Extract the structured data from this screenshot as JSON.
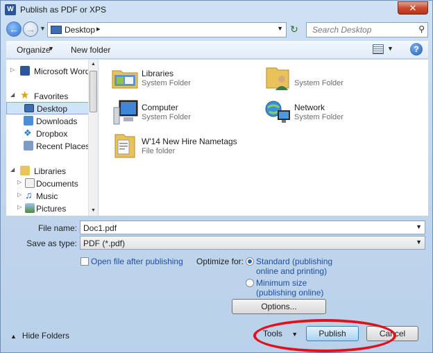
{
  "window": {
    "title": "Publish as PDF or XPS",
    "close_label": "✕",
    "app_icon_letter": "W"
  },
  "navbar": {
    "back_icon": "back-arrow-icon",
    "forward_icon": "forward-arrow-icon",
    "address": "Desktop",
    "search_placeholder": "Search Desktop"
  },
  "toolbar": {
    "organize": "Organize",
    "new_folder": "New folder"
  },
  "nav_pane": {
    "items": [
      {
        "label": "Microsoft Word",
        "icon": "word-icon",
        "caret": "▷"
      },
      {
        "label": "Favorites",
        "icon": "star-icon",
        "caret": "◢"
      },
      {
        "label": "Desktop",
        "icon": "desktop-icon",
        "selected": true
      },
      {
        "label": "Downloads",
        "icon": "downloads-icon"
      },
      {
        "label": "Dropbox",
        "icon": "dropbox-icon"
      },
      {
        "label": "Recent Places",
        "icon": "recent-places-icon"
      },
      {
        "label": "Libraries",
        "icon": "libraries-icon",
        "caret": "◢"
      },
      {
        "label": "Documents",
        "icon": "documents-icon",
        "caret": "▷"
      },
      {
        "label": "Music",
        "icon": "music-icon",
        "caret": "▷"
      },
      {
        "label": "Pictures",
        "icon": "pictures-icon",
        "caret": "▷"
      }
    ]
  },
  "files": [
    {
      "name": "Libraries",
      "type": "System Folder",
      "icon": "libraries-folder-icon"
    },
    {
      "name": "",
      "type": "System Folder",
      "icon": "user-folder-icon"
    },
    {
      "name": "Computer",
      "type": "System Folder",
      "icon": "computer-icon"
    },
    {
      "name": "Network",
      "type": "System Folder",
      "icon": "network-icon"
    },
    {
      "name": "W'14 New Hire Nametags",
      "type": "File folder",
      "icon": "folder-icon"
    }
  ],
  "form": {
    "file_name_label": "File name:",
    "file_name_value": "Doc1.pdf",
    "save_type_label": "Save as type:",
    "save_type_value": "PDF (*.pdf)",
    "open_after_label": "Open file after publishing",
    "open_after_checked": false,
    "optimize_label": "Optimize for:",
    "standard_line1": "Standard (publishing",
    "standard_line2": "online and printing)",
    "minimum_line1": "Minimum size",
    "minimum_line2": "(publishing online)",
    "selected_option": "standard",
    "options_button": "Options..."
  },
  "footer": {
    "hide_folders": "Hide Folders",
    "tools": "Tools",
    "publish": "Publish",
    "cancel": "Cancel"
  },
  "colors": {
    "annotation_ellipse": "#e3101a",
    "window_bg": "#bfd5ec",
    "link_blue": "#1f4fa0"
  }
}
